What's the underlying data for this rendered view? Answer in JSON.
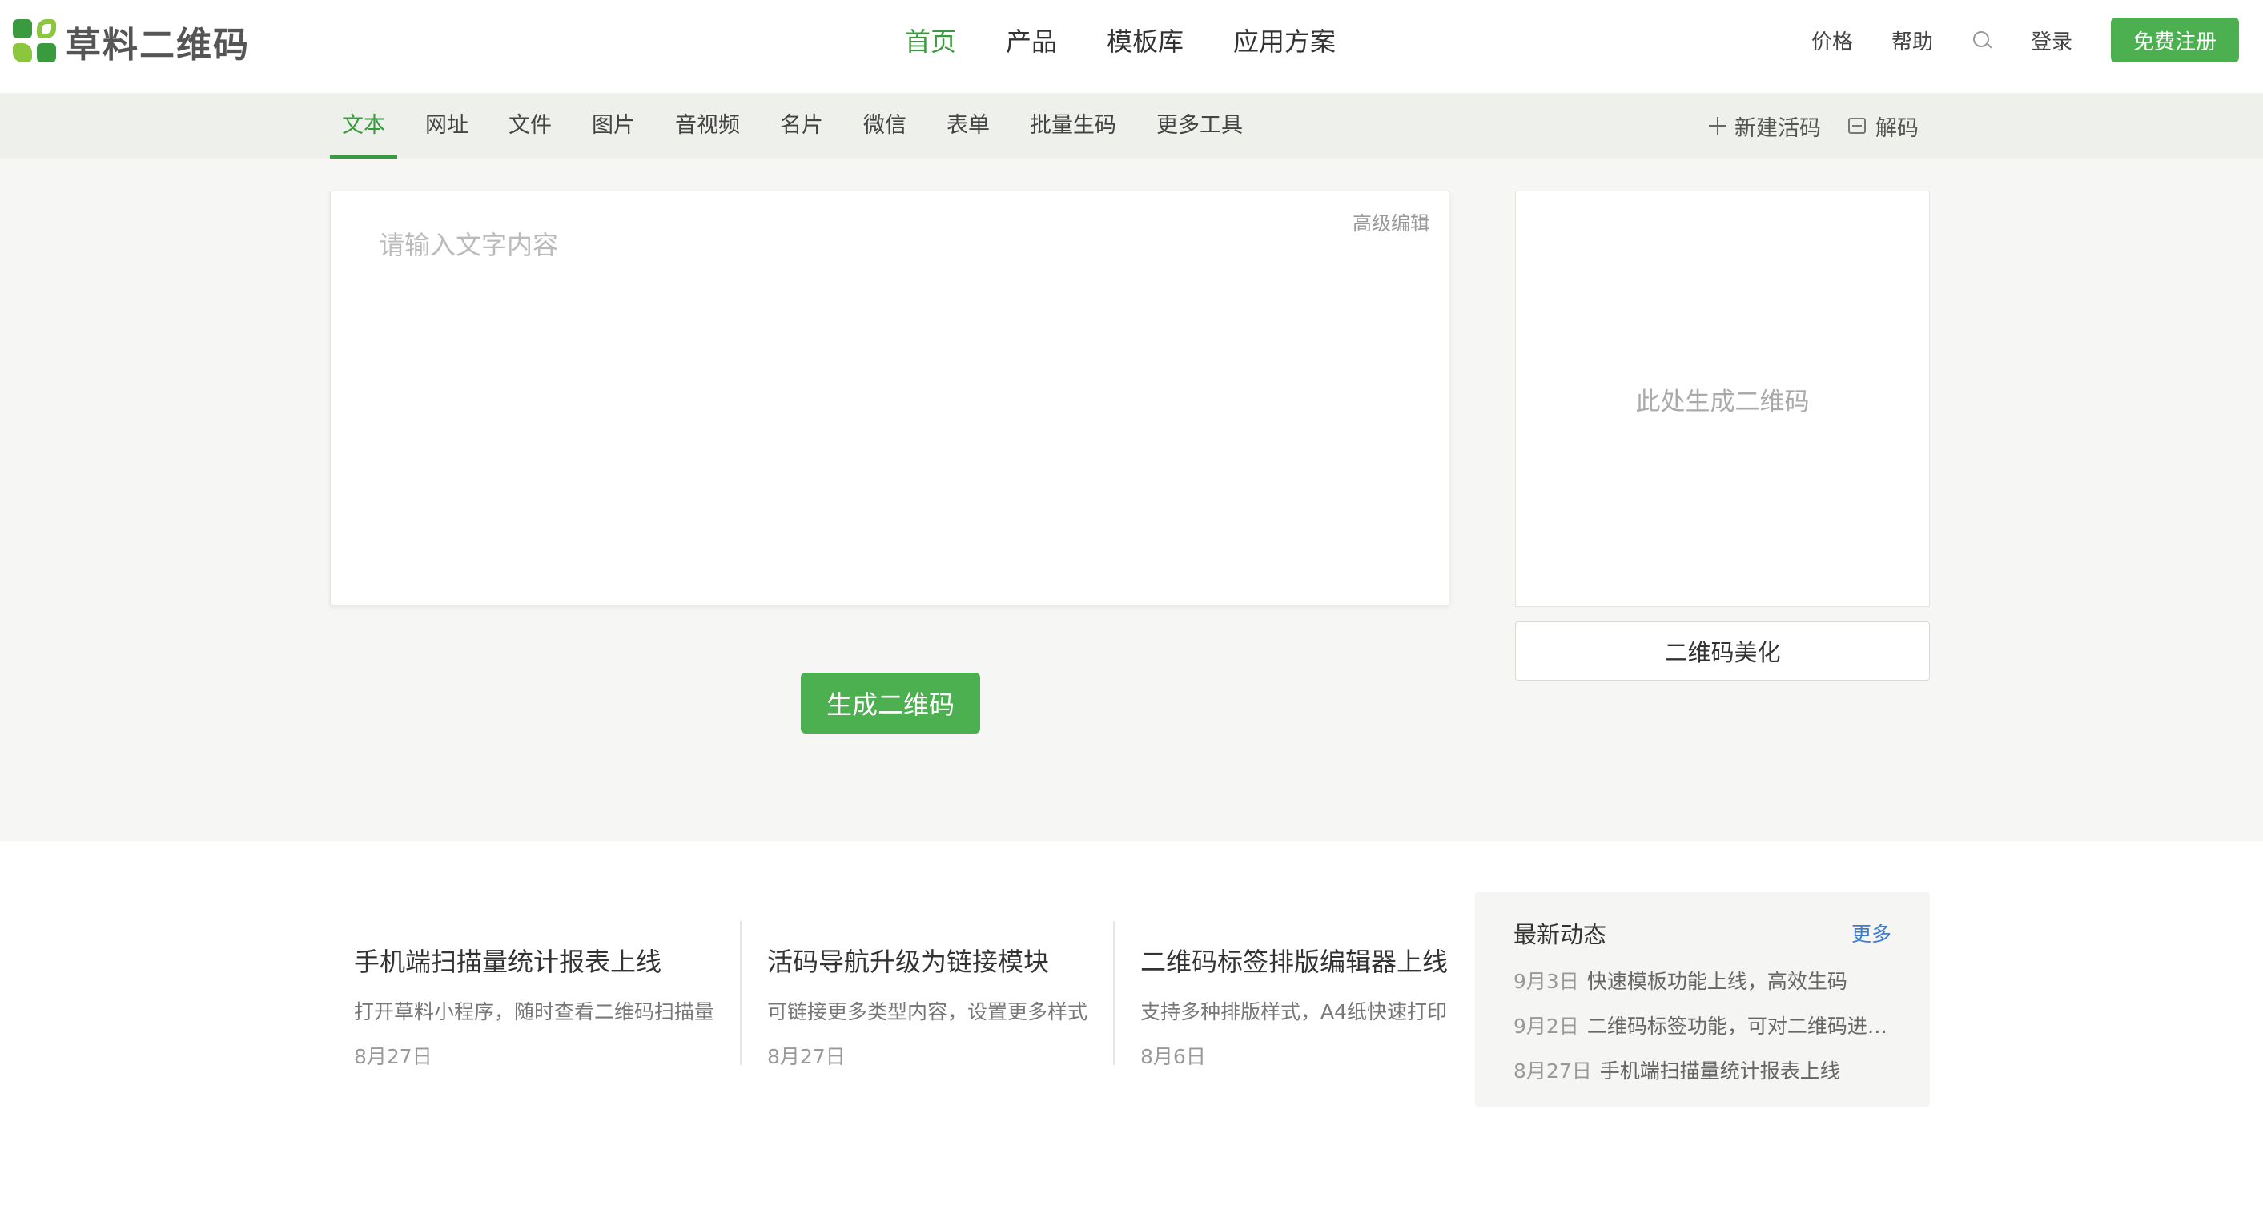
{
  "brand": {
    "name": "草料二维码",
    "accent": "#3a9a3e",
    "button_green": "#4caf50"
  },
  "header": {
    "nav": [
      {
        "label": "首页",
        "active": true
      },
      {
        "label": "产品",
        "active": false
      },
      {
        "label": "模板库",
        "active": false
      },
      {
        "label": "应用方案",
        "active": false
      }
    ],
    "price": "价格",
    "help": "帮助",
    "search_icon": "search-icon",
    "login": "登录",
    "register": "免费注册"
  },
  "subnav": {
    "tabs": [
      {
        "label": "文本",
        "active": true
      },
      {
        "label": "网址",
        "active": false
      },
      {
        "label": "文件",
        "active": false
      },
      {
        "label": "图片",
        "active": false
      },
      {
        "label": "音视频",
        "active": false
      },
      {
        "label": "名片",
        "active": false
      },
      {
        "label": "微信",
        "active": false
      },
      {
        "label": "表单",
        "active": false
      },
      {
        "label": "批量生码",
        "active": false
      },
      {
        "label": "更多工具",
        "active": false
      }
    ],
    "new_code": "新建活码",
    "decode": "解码"
  },
  "editor": {
    "placeholder": "请输入文字内容",
    "value": "",
    "advanced": "高级编辑",
    "generate": "生成二维码"
  },
  "qr": {
    "placeholder": "此处生成二维码",
    "beautify": "二维码美化"
  },
  "news": [
    {
      "title": "手机端扫描量统计报表上线",
      "desc": "打开草料小程序，随时查看二维码扫描量",
      "date": "8月27日"
    },
    {
      "title": "活码导航升级为链接模块",
      "desc": "可链接更多类型内容，设置更多样式",
      "date": "8月27日"
    },
    {
      "title": "二维码标签排版编辑器上线",
      "desc": "支持多种排版样式，A4纸快速打印",
      "date": "8月6日"
    }
  ],
  "updates": {
    "title": "最新动态",
    "more": "更多",
    "items": [
      {
        "date": "9月3日",
        "text": "快速模板功能上线，高效生码"
      },
      {
        "date": "9月2日",
        "text": "二维码标签功能，可对二维码进行..."
      },
      {
        "date": "8月27日",
        "text": "手机端扫描量统计报表上线"
      }
    ]
  }
}
